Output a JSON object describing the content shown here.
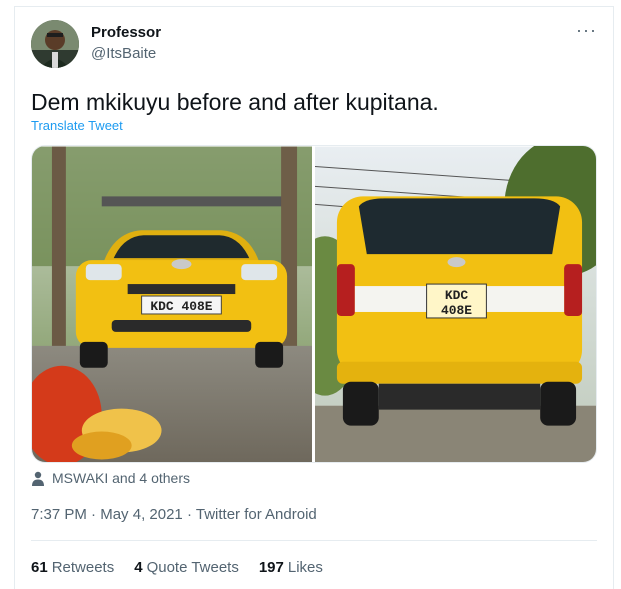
{
  "author": {
    "name": "Professor",
    "handle": "@ItsBaite"
  },
  "tweet": {
    "text": "Dem mkikuyu before and after kupitana.",
    "translate_label": "Translate Tweet",
    "more_icon": "more-horizontal-icon"
  },
  "media": {
    "plate_before": "KDC 408E",
    "plate_after_line1": "KDC",
    "plate_after_line2": "408E",
    "car_color": "#f2c012"
  },
  "social_context": {
    "icon": "person-icon",
    "text": "MSWAKI and 4 others"
  },
  "meta": {
    "time": "7:37 PM",
    "separator1": "·",
    "date": "May 4, 2021",
    "separator2": "·",
    "source": "Twitter for Android"
  },
  "stats": {
    "retweets_count": "61",
    "retweets_label": "Retweets",
    "quotes_count": "4",
    "quotes_label": "Quote Tweets",
    "likes_count": "197",
    "likes_label": "Likes"
  },
  "colors": {
    "link": "#1d9bf0",
    "secondary": "#536471",
    "primary": "#0f1419"
  }
}
